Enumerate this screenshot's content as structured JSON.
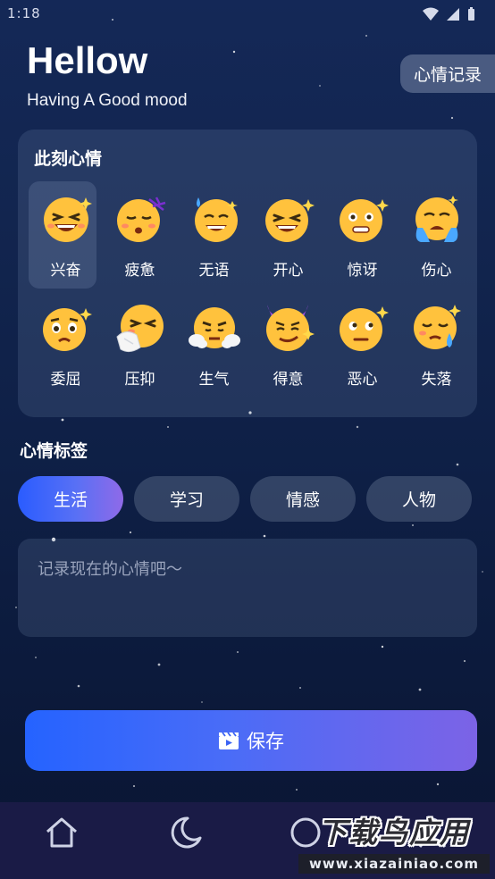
{
  "status_bar": {
    "time": "1:18"
  },
  "header": {
    "title": "Hellow",
    "subtitle": "Having A Good mood"
  },
  "record_button": {
    "label": "心情记录"
  },
  "mood_card": {
    "title": "此刻心情",
    "selected_index": 0,
    "moods": [
      {
        "label": "兴奋",
        "icon": "excited-face-icon"
      },
      {
        "label": "疲惫",
        "icon": "tired-face-icon"
      },
      {
        "label": "无语",
        "icon": "speechless-face-icon"
      },
      {
        "label": "开心",
        "icon": "happy-face-icon"
      },
      {
        "label": "惊讶",
        "icon": "surprised-face-icon"
      },
      {
        "label": "伤心",
        "icon": "sad-crying-face-icon"
      },
      {
        "label": "委屈",
        "icon": "aggrieved-face-icon"
      },
      {
        "label": "压抑",
        "icon": "depressed-face-icon"
      },
      {
        "label": "生气",
        "icon": "angry-face-icon"
      },
      {
        "label": "得意",
        "icon": "smug-devil-face-icon"
      },
      {
        "label": "恶心",
        "icon": "disgusted-face-icon"
      },
      {
        "label": "失落",
        "icon": "disappointed-face-icon"
      }
    ]
  },
  "tags": {
    "title": "心情标签",
    "items": [
      {
        "label": "生活",
        "active": true
      },
      {
        "label": "学习",
        "active": false
      },
      {
        "label": "情感",
        "active": false
      },
      {
        "label": "人物",
        "active": false
      }
    ]
  },
  "note": {
    "placeholder": "记录现在的心情吧～",
    "value": ""
  },
  "save_button": {
    "label": "保存",
    "icon": "video-clip-icon"
  },
  "bottom_nav": {
    "items": [
      {
        "icon": "home-icon"
      },
      {
        "icon": "moon-icon"
      },
      {
        "icon": "circle-icon"
      },
      {
        "icon": "person-icon"
      }
    ]
  },
  "watermark": {
    "main": "下载鸟应用",
    "sub": "www.xiazainiao.com"
  },
  "colors": {
    "accent_start": "#2563ff",
    "accent_end": "#7c63e6",
    "background": "#12254f",
    "nav_background": "#1a1b46"
  }
}
